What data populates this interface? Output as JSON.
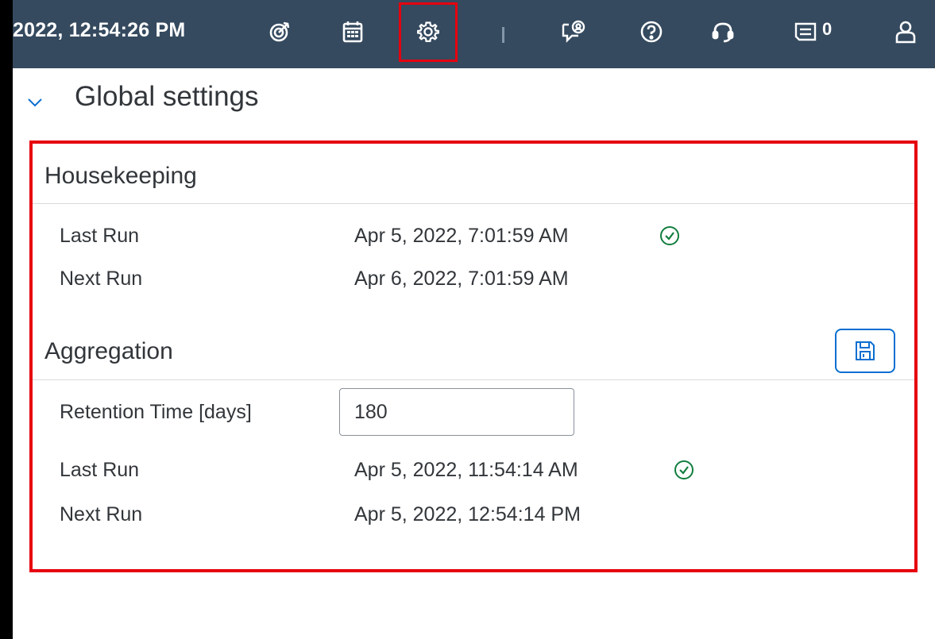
{
  "shellbar": {
    "datetime": "2022, 12:54:26 PM",
    "notification_count": "0",
    "icons": [
      "target-icon",
      "calendar-icon",
      "settings-gear-icon",
      "feedback-icon",
      "help-icon",
      "support-headset-icon",
      "notifications-icon",
      "user-icon"
    ]
  },
  "panel": {
    "title": "Global settings"
  },
  "housekeeping": {
    "title": "Housekeeping",
    "last_run_label": "Last Run",
    "last_run_value": "Apr 5, 2022, 7:01:59 AM",
    "next_run_label": "Next Run",
    "next_run_value": "Apr 6, 2022, 7:01:59 AM",
    "status": "success"
  },
  "aggregation": {
    "title": "Aggregation",
    "retention_label": "Retention Time [days]",
    "retention_value": "180",
    "last_run_label": "Last Run",
    "last_run_value": "Apr 5, 2022, 11:54:14 AM",
    "next_run_label": "Next Run",
    "next_run_value": "Apr 5, 2022, 12:54:14 PM",
    "status": "success"
  },
  "colors": {
    "shell_background": "#354a5f",
    "highlight": "#e6000f",
    "success": "#107e3e",
    "accent": "#0a6ed1"
  }
}
